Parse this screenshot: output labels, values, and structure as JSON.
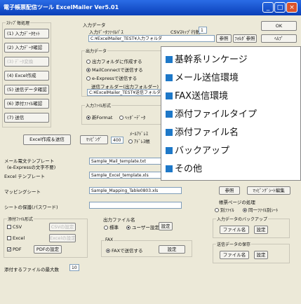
{
  "window": {
    "title": "電子帳票配信ツール ExcelMailer Ver5.01",
    "min": "_",
    "max": "□",
    "close": "×"
  },
  "sidebar": {
    "group_title": "ｽﾃｯﾌﾟ毎処理",
    "items": [
      {
        "label": "(1) 入力ﾃﾞｰﾀｾｯﾄ"
      },
      {
        "label": "(2) 入力ﾃﾞｰﾀ確認"
      },
      {
        "label": "(3) ﾃﾞｰﾀ変換"
      },
      {
        "label": "(4) Excel作成"
      },
      {
        "label": "(5) 送信データ確認"
      },
      {
        "label": "(6) 添付ﾌｧｲﾙ確認"
      },
      {
        "label": "(7) 送信"
      }
    ],
    "excel_send": "Excel作成＆送信",
    "error_list": "ｴﾗｰﾘｽﾄ"
  },
  "top_buttons": {
    "ok": "OK",
    "browse": "参照",
    "open_folder": "ﾌｫﾙﾀﾞ参照",
    "help": "ﾍﾙﾌﾟ"
  },
  "input_data": {
    "group": "入力データ",
    "file_label": "入力ﾃﾞｰﾀﾌｧｲﾙﾊﾟｽ",
    "csv_skip_label": "CSVｽｷｯﾌﾟ行数",
    "csv_skip_value": "1",
    "file_value": "C:¥ExcelMailer_TEST¥入力フォルダ"
  },
  "output_data": {
    "group": "出力データ",
    "opt1": "出力フォルダに作成する",
    "opt2": "MailConnectで送信する",
    "opt3": "e-Expressで送信する",
    "backup_label": "送信フォルダー(出力フォルダー)",
    "backup_value": "C:¥ExcelMailer_TEST¥送信フォルダ"
  },
  "input_format": {
    "group": "入力ﾌｧｲﾙ形式",
    "opt1": "新Format",
    "opt2": "ﾍｯﾀﾞｰﾃﾞｰﾀ"
  },
  "mapping": {
    "btn": "ﾏｯﾋﾟﾝｸﾞ",
    "value": "400",
    "mail_addr_label": "ﾒｰﾙｱﾄﾞﾚｽ",
    "opt": "ｱﾄﾞﾚｽ帳"
  },
  "templates": {
    "mail_label": "メール電文テンプレート",
    "mail_sub": "(e-Expressの文字不要)",
    "mail_value": "Sample_Mail_template.txt",
    "excel_label": "Excel テンプレート",
    "excel_value": "Sample_Excel_template.xls",
    "mapping_label": "マッピングシート",
    "mapping_value": "Sample_Mapping_Table0803.xls",
    "protect_label": "シートの保護(パスワード)",
    "browse": "参照",
    "mapping_edit": "ﾏｯﾋﾟﾝｸﾞｼｰﾄ編集"
  },
  "email_page": {
    "group": "帳票ページの処理",
    "opt1": "別ﾌｧｲﾙ",
    "opt2": "同一ﾌｧｲﾙ別ｼｰﾄ"
  },
  "attach_format": {
    "group": "添付ﾌｧｲﾙ形式",
    "csv": "CSV",
    "csv_btn": "CSVの設定",
    "excel": "Excel",
    "excel_btn": "Excelの設定",
    "pdf": "PDF",
    "pdf_btn": "PDFの設定"
  },
  "output_filename": {
    "group": "出力ファイル名",
    "opt1": "標準",
    "opt2": "ユーザー設定",
    "set": "設定"
  },
  "fax": {
    "group": "FAX",
    "opt": "FAXで送信する",
    "set": "設定"
  },
  "input_backup": {
    "group": "入力データのバックアップ",
    "btn": "ファイル名",
    "set": "設定"
  },
  "save_send": {
    "group": "送信データの保存",
    "btn": "ファイル名",
    "set": "設定"
  },
  "max_files": {
    "label": "添付するファイルの最大数",
    "value": "10"
  },
  "overlay": {
    "items": [
      "基幹系リンケージ",
      "メール送信環境",
      "FAX送信環境",
      "添付ファイルタイプ",
      "添付ファイル名",
      "バックアップ",
      "その他"
    ],
    "bullet_color": "#1e78c8"
  }
}
